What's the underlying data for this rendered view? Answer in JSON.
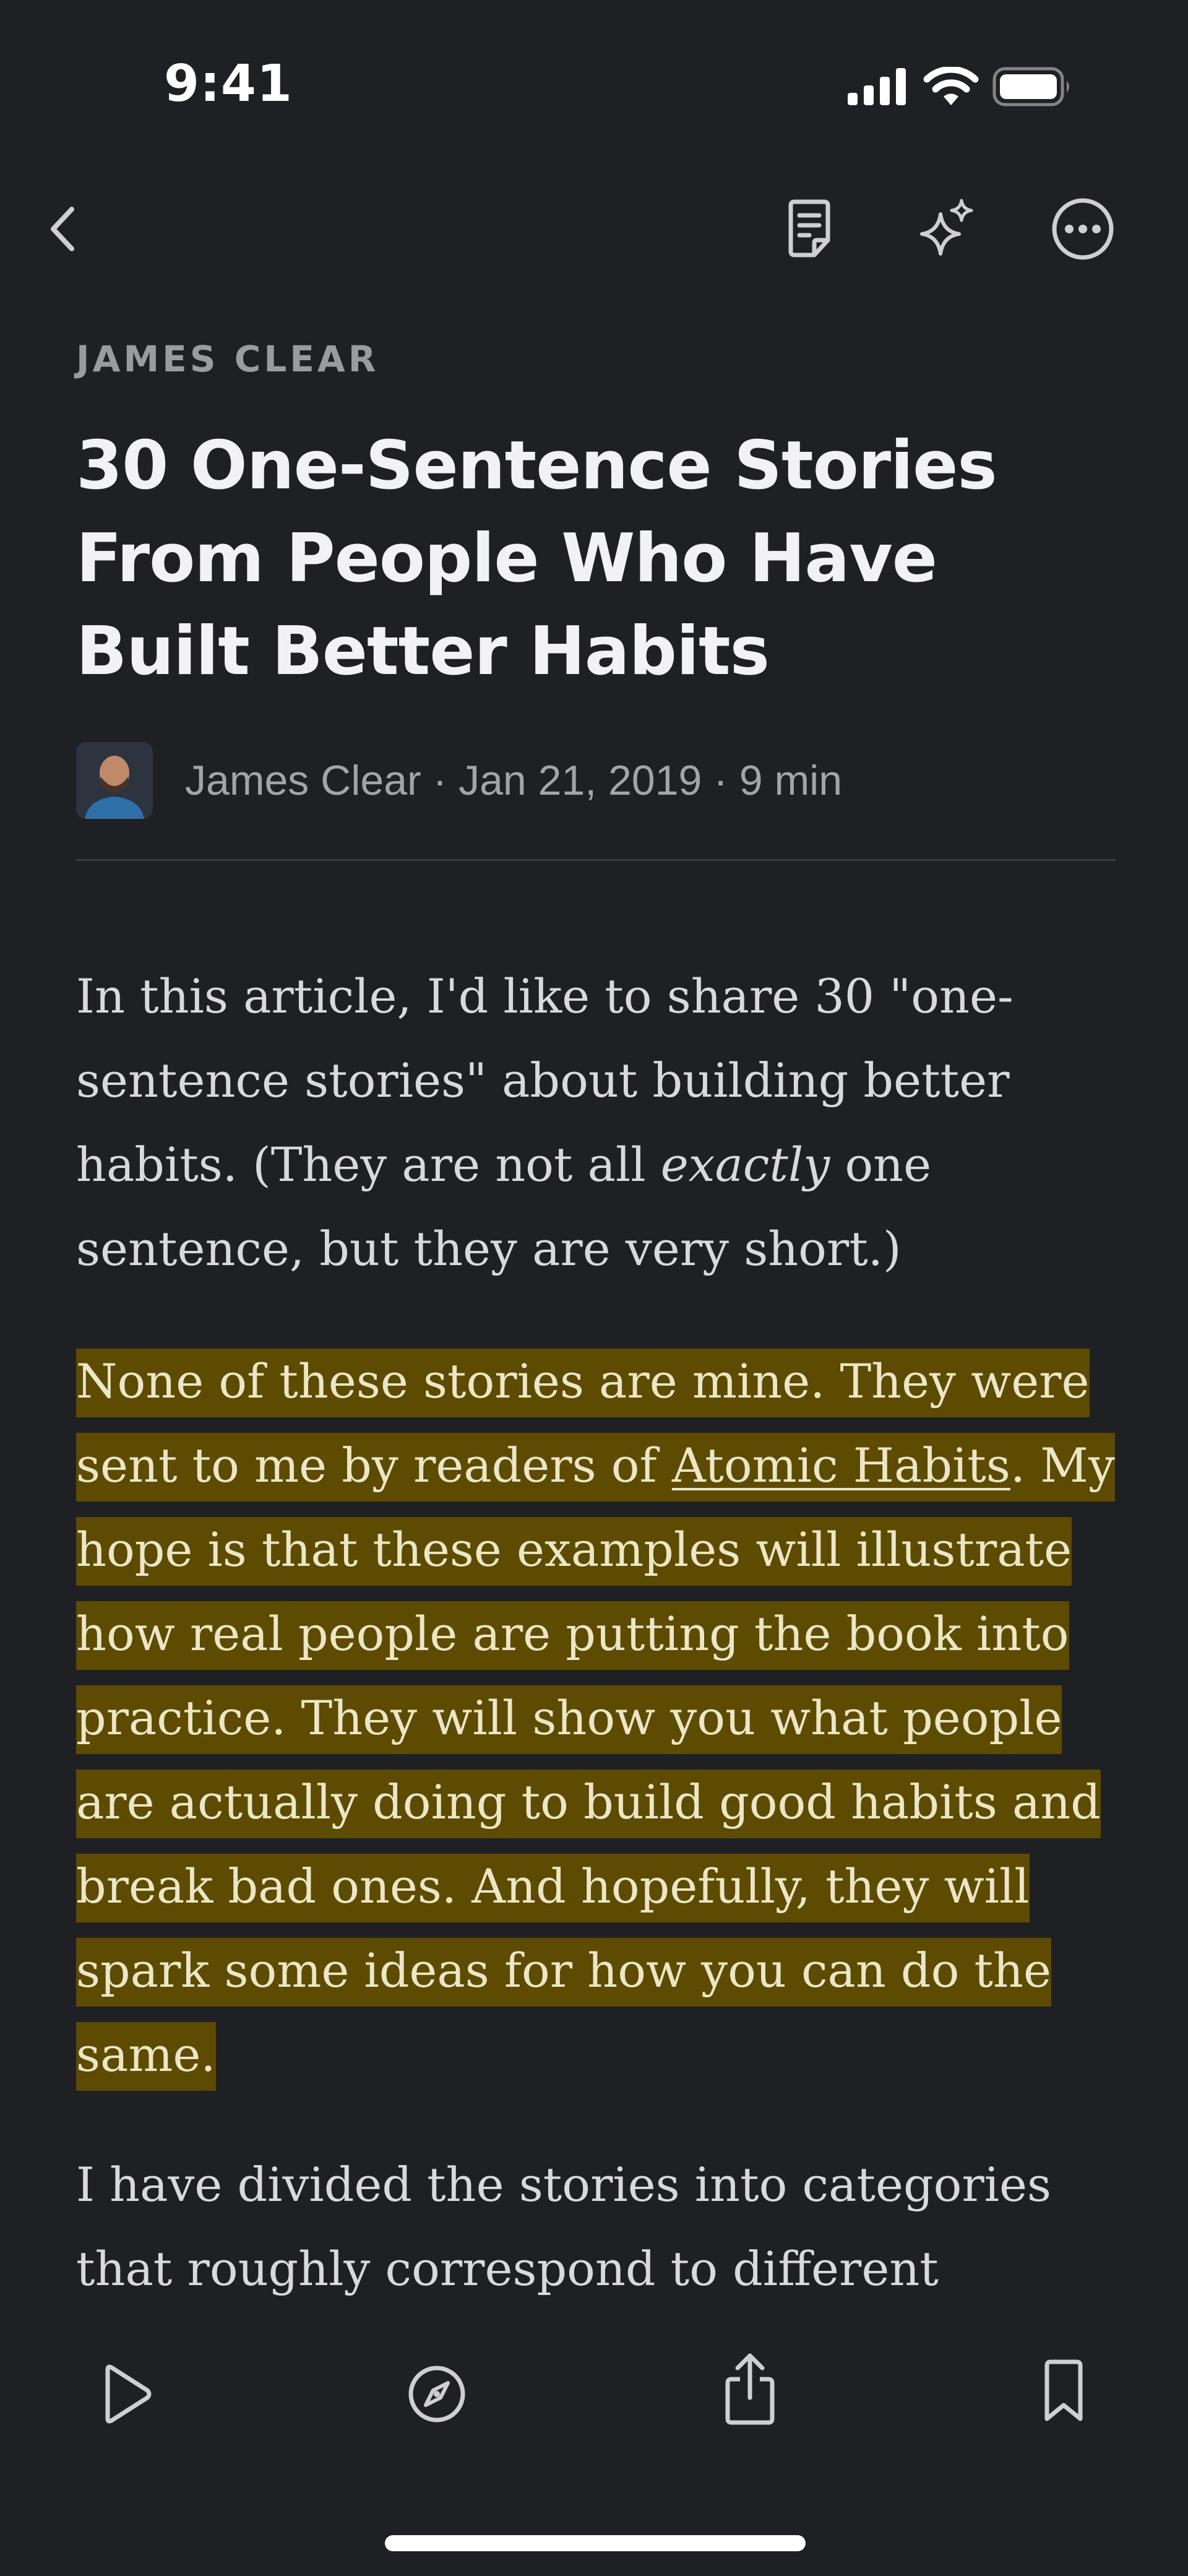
{
  "status_bar": {
    "time": "9:41",
    "icons": [
      "signal-icon",
      "wifi-icon",
      "battery-icon"
    ]
  },
  "top_toolbar": {
    "icons": [
      "back-chevron-icon",
      "document-notes-icon",
      "sparkle-icon",
      "more-ellipsis-icon"
    ]
  },
  "article": {
    "source": "JAMES CLEAR",
    "title": "30 One-Sentence Stories From People Who Have Built Better Habits",
    "byline": "James Clear · Jan 21, 2019 · 9 min",
    "para1_a": "In this article, I'd like to share 30 \"one-sentence stories\" about building better habits. (They are not all ",
    "para1_em": "exactly",
    "para1_b": " one sentence, but they are very short.)",
    "para2_a": "None of these stories are mine. They were sent to me by readers of ",
    "para2_link": "Atomic Habits",
    "para2_b": ". My hope is that these examples will illustrate how real people are putting the book into practice. They will show you what people are actually doing to build good habits and break bad ones. And hopefully, they will spark some ideas for how you can do the same.",
    "para3": "I have divided the stories into categories that roughly correspond to different sections or ideas in the book."
  },
  "bottom_toolbar": {
    "icons": [
      "play-icon",
      "compass-icon",
      "share-icon",
      "bookmark-icon"
    ]
  },
  "colors": {
    "background": "#1f2024",
    "highlight": "#5d4c00",
    "text": "#d9d9db",
    "muted": "#a3a4a9"
  }
}
